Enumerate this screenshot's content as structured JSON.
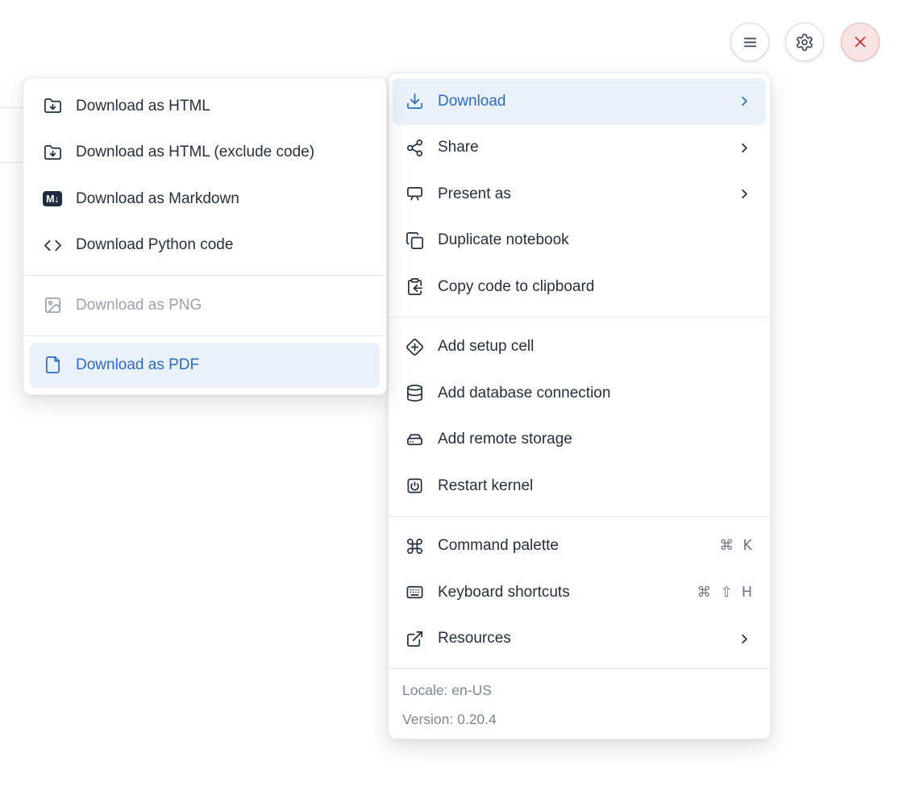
{
  "toolbar": {
    "menu_button": {
      "icon": "hamburger-icon"
    },
    "settings_button": {
      "icon": "gear-icon"
    },
    "close_button": {
      "icon": "close-icon"
    }
  },
  "main_menu": {
    "groups": [
      {
        "items": [
          {
            "label": "Download",
            "icon": "download-icon",
            "has_submenu": true,
            "active": true
          },
          {
            "label": "Share",
            "icon": "share-icon",
            "has_submenu": true
          },
          {
            "label": "Present as",
            "icon": "presentation-icon",
            "has_submenu": true
          },
          {
            "label": "Duplicate notebook",
            "icon": "duplicate-icon"
          },
          {
            "label": "Copy code to clipboard",
            "icon": "clipboard-copy-icon"
          }
        ]
      },
      {
        "items": [
          {
            "label": "Add setup cell",
            "icon": "diamond-plus-icon"
          },
          {
            "label": "Add database connection",
            "icon": "database-icon"
          },
          {
            "label": "Add remote storage",
            "icon": "storage-drive-icon"
          },
          {
            "label": "Restart kernel",
            "icon": "power-square-icon"
          }
        ]
      },
      {
        "items": [
          {
            "label": "Command palette",
            "icon": "command-icon",
            "shortcut": "⌘ K"
          },
          {
            "label": "Keyboard shortcuts",
            "icon": "keyboard-icon",
            "shortcut": "⌘ ⇧ H"
          },
          {
            "label": "Resources",
            "icon": "external-link-icon",
            "has_submenu": true
          }
        ]
      }
    ],
    "footer": {
      "locale": "Locale: en-US",
      "version": "Version: 0.20.4"
    }
  },
  "download_submenu": {
    "markdown_badge": "M↓",
    "groups": [
      {
        "items": [
          {
            "label": "Download as HTML",
            "icon": "folder-down-icon"
          },
          {
            "label": "Download as HTML (exclude code)",
            "icon": "folder-down-icon"
          },
          {
            "label": "Download as Markdown",
            "icon": "markdown-icon"
          },
          {
            "label": "Download Python code",
            "icon": "code-icon"
          }
        ]
      },
      {
        "items": [
          {
            "label": "Download as PNG",
            "icon": "image-icon",
            "disabled": true
          }
        ]
      },
      {
        "items": [
          {
            "label": "Download as PDF",
            "icon": "file-icon",
            "active": true
          }
        ]
      }
    ]
  },
  "colors": {
    "accent_blue": "#2e6bc4",
    "highlight_bg": "#e9f1fb",
    "text": "#25303f",
    "muted_gray": "#7d8795",
    "shortcut_gray": "#6d7789",
    "disabled_gray": "#9aa2ad",
    "separator": "#e4e6ea",
    "danger_red": "#c43c3c",
    "danger_bg": "#f9e4e3",
    "danger_border": "#eab7b3"
  }
}
